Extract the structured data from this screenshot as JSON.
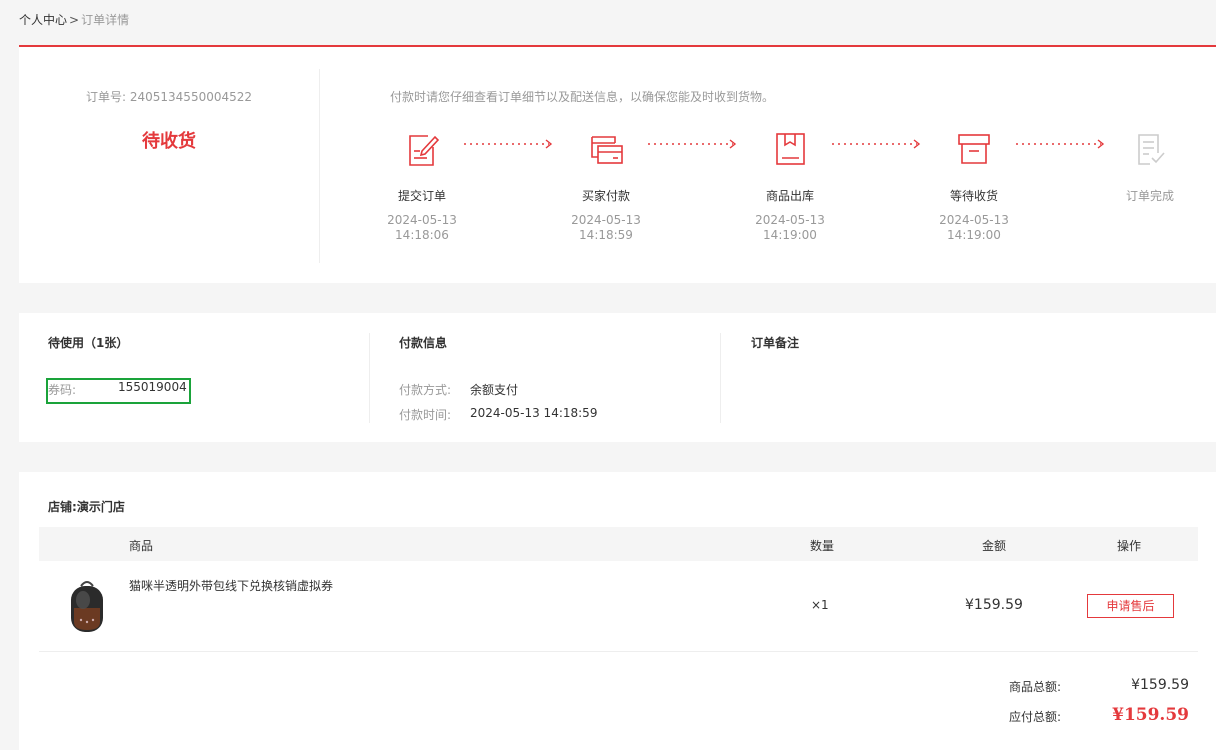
{
  "breadcrumb": {
    "home": "个人中心",
    "separator": ">",
    "current": "订单详情"
  },
  "order": {
    "number_label": "订单号:",
    "number": "2405134550004522",
    "status": "待收货",
    "pay_tip": "付款时请您仔细查看订单细节以及配送信息，以确保您能及时收到货物。"
  },
  "steps": [
    {
      "label": "提交订单",
      "date": "2024-05-13",
      "time": "14:18:06",
      "icon": "submit-order-icon",
      "color": "#e4393c"
    },
    {
      "label": "买家付款",
      "date": "2024-05-13",
      "time": "14:18:59",
      "icon": "payment-card-icon",
      "color": "#e4393c"
    },
    {
      "label": "商品出库",
      "date": "2024-05-13",
      "time": "14:19:00",
      "icon": "goods-out-icon",
      "color": "#e4393c"
    },
    {
      "label": "等待收货",
      "date": "2024-05-13",
      "time": "14:19:00",
      "icon": "awaiting-receipt-icon",
      "color": "#e4393c"
    },
    {
      "label": "订单完成",
      "date": "",
      "time": "",
      "icon": "order-complete-icon",
      "color": "#cccccc"
    }
  ],
  "coupon": {
    "title": "待使用（1张）",
    "label": "券码:",
    "code": "155019004"
  },
  "payment": {
    "title": "付款信息",
    "method_label": "付款方式:",
    "method": "余额支付",
    "time_label": "付款时间:",
    "time": "2024-05-13 14:18:59"
  },
  "remark": {
    "title": "订单备注"
  },
  "shop": {
    "label": "店铺:",
    "name": "演示门店"
  },
  "table": {
    "headers": {
      "product": "商品",
      "quantity": "数量",
      "amount": "金额",
      "action": "操作"
    }
  },
  "item": {
    "name": "猫咪半透明外带包线下兑换核销虚拟券",
    "quantity": "×1",
    "price": "¥159.59",
    "action_label": "申请售后"
  },
  "summary": {
    "goods_total_label": "商品总额:",
    "goods_total": "¥159.59",
    "payable_label": "应付总额:",
    "payable": "¥159.59"
  },
  "colors": {
    "accent": "#e4393c",
    "coupon_border": "#1aa33a",
    "muted": "#999999"
  }
}
